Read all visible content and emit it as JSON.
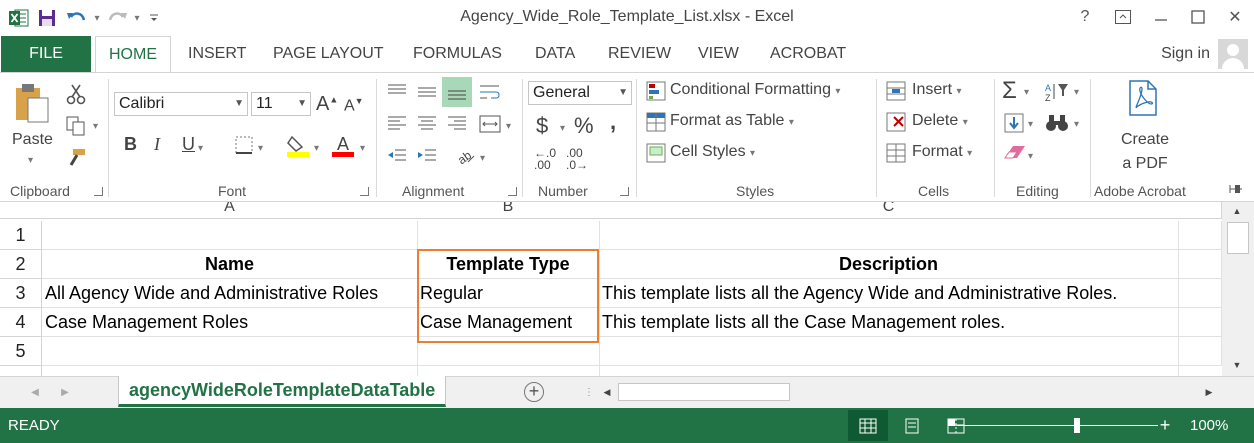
{
  "window": {
    "title": "Agency_Wide_Role_Template_List.xlsx - Excel",
    "help": "?",
    "close": "✕"
  },
  "tabs": {
    "file": "FILE",
    "items": [
      "HOME",
      "INSERT",
      "PAGE LAYOUT",
      "FORMULAS",
      "DATA",
      "REVIEW",
      "VIEW",
      "ACROBAT"
    ],
    "active": "HOME",
    "sign_in": "Sign in"
  },
  "ribbon": {
    "clipboard": {
      "label": "Clipboard",
      "paste": "Paste"
    },
    "font": {
      "label": "Font",
      "name": "Calibri",
      "size": "11",
      "bold": "B",
      "italic": "I",
      "underline": "U",
      "font_color": "#ff0000",
      "fill_color": "#ffff00"
    },
    "alignment": {
      "label": "Alignment"
    },
    "number": {
      "label": "Number",
      "format": "General",
      "currency": "$",
      "percent": "%",
      "comma": ",",
      "inc_decimal": ".00",
      "dec_decimal": ".00",
      "dec_a": "←.0",
      "dec_b": ".0→"
    },
    "styles": {
      "label": "Styles",
      "conditional": "Conditional Formatting",
      "table": "Format as Table",
      "cell_styles": "Cell Styles"
    },
    "cells": {
      "label": "Cells",
      "insert": "Insert",
      "delete": "Delete",
      "format": "Format"
    },
    "editing": {
      "label": "Editing",
      "sum": "Σ"
    },
    "acrobat": {
      "label": "Adobe Acrobat",
      "create_line1": "Create",
      "create_line2": "a PDF"
    }
  },
  "sheet": {
    "columns": [
      "A",
      "B",
      "C"
    ],
    "rows": [
      {
        "num": "1",
        "a": "",
        "b": "",
        "c": ""
      },
      {
        "num": "2",
        "a": "Name",
        "b": "Template Type",
        "c": "Description"
      },
      {
        "num": "3",
        "a": "All Agency Wide and Administrative Roles",
        "b": "Regular",
        "c": "This template lists all the Agency Wide and Administrative Roles."
      },
      {
        "num": "4",
        "a": "Case Management Roles",
        "b": "Case Management",
        "c": "This template lists all the Case Management roles."
      },
      {
        "num": "5",
        "a": "",
        "b": "",
        "c": ""
      }
    ],
    "highlight_color": "#ed7d31",
    "tab_name": "agencyWideRoleTemplateDataTable",
    "add_sheet": "+"
  },
  "status": {
    "ready": "READY",
    "zoom": "100%",
    "zoom_out": "−",
    "zoom_in": "+"
  },
  "colors": {
    "excel_green": "#217346"
  }
}
